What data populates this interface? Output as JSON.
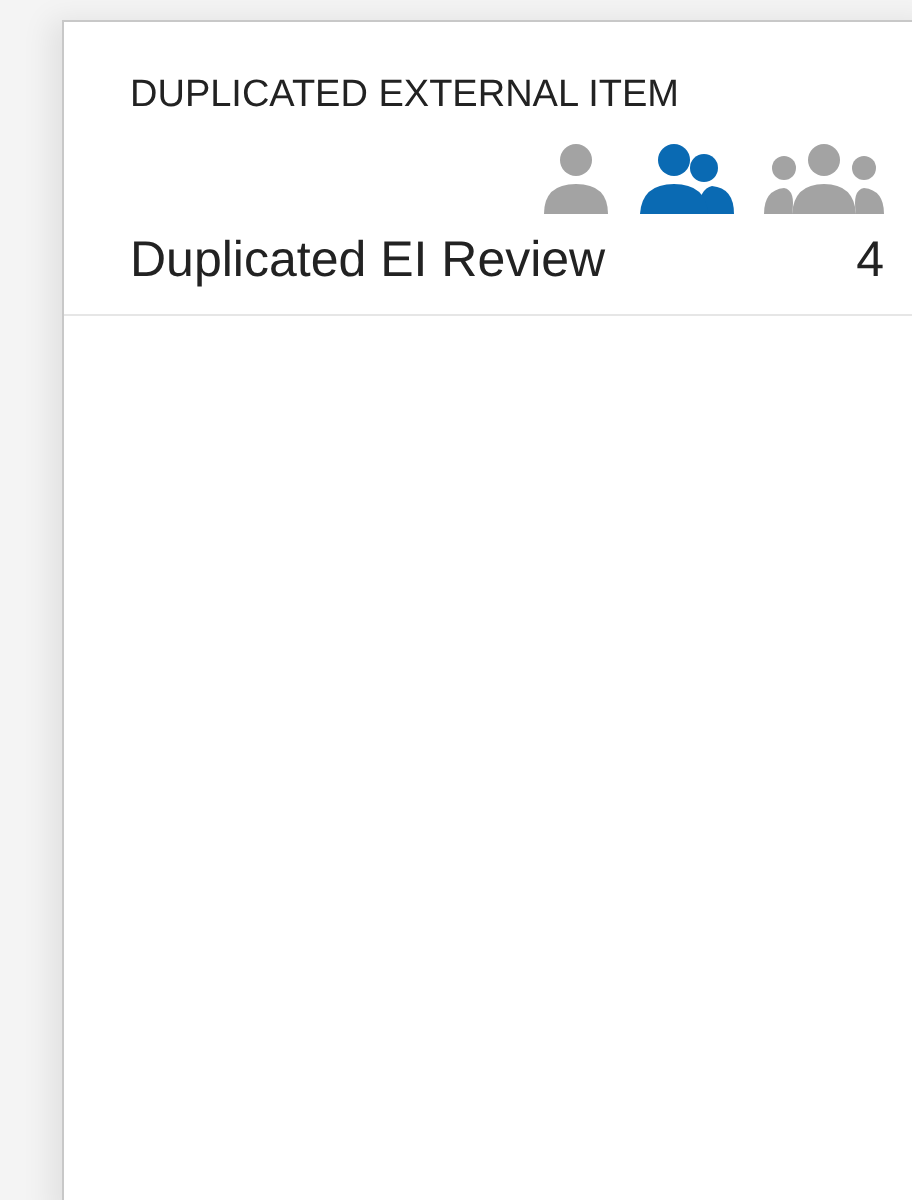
{
  "card": {
    "title": "DUPLICATED EXTERNAL ITEM",
    "scopes": [
      {
        "kind": "single",
        "selected": false
      },
      {
        "kind": "pair",
        "selected": true
      },
      {
        "kind": "group",
        "selected": false
      }
    ],
    "rows": [
      {
        "label": "Duplicated EI Review",
        "count": "4"
      }
    ]
  }
}
